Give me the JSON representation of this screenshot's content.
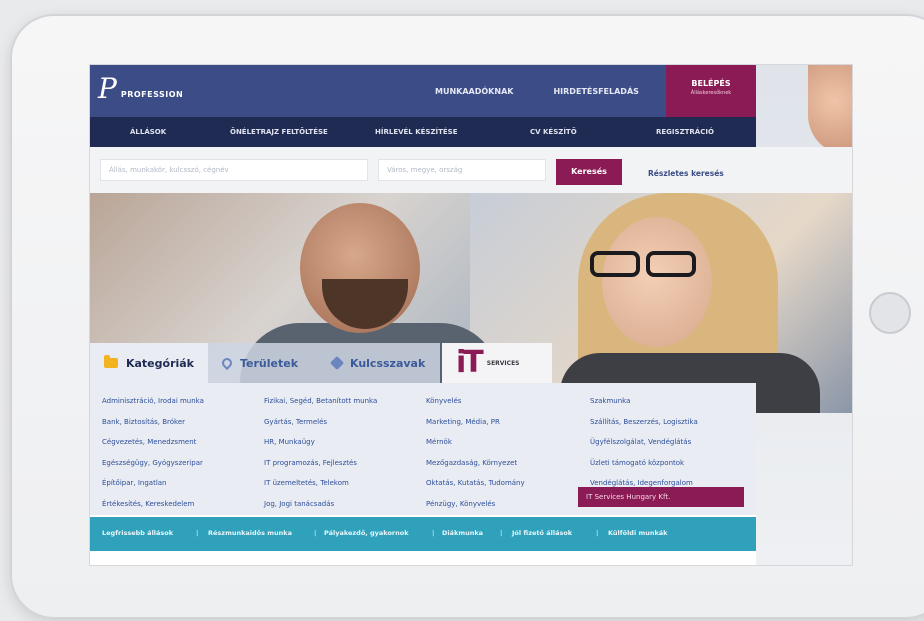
{
  "brand": {
    "logo_letter": "P",
    "name": "PROFESSION"
  },
  "topnav": {
    "items": [
      "MUNKAADÓKNAK",
      "HIRDETÉSFELADÁS"
    ]
  },
  "login": {
    "label": "BELÉPÉS",
    "sub": "Álláskeresőknek"
  },
  "subnav": {
    "items": [
      "ÁLLÁSOK",
      "ÖNÉLETRAJZ FELTÖLTÉSE",
      "HÍRLEVÉL KÉSZÍTÉSE",
      "CV KÉSZÍTŐ",
      "REGISZTRÁCIÓ"
    ]
  },
  "search": {
    "keyword_placeholder": "Állás, munkakör, kulcsszó, cégnév",
    "location_placeholder": "Város, megye, ország",
    "button": "Keresés",
    "advanced": "Részletes keresés"
  },
  "tabs": {
    "categories": "Kategóriák",
    "areas": "Területek",
    "keywords": "Kulcsszavak"
  },
  "it_logo": {
    "mark": "iT",
    "sub": "SERVICES"
  },
  "categories": {
    "col1": [
      "Adminisztráció, Irodai munka",
      "Bank, Biztosítás, Bróker",
      "Cégvezetés, Menedzsment",
      "Egészségügy, Gyógyszeripar",
      "Építőipar, Ingatlan",
      "Értékesítés, Kereskedelem"
    ],
    "col2": [
      "Fizikai, Segéd, Betanított munka",
      "Gyártás, Termelés",
      "HR, Munkaügy",
      "IT programozás, Fejlesztés",
      "IT üzemeltetés, Telekom",
      "Jog, Jogi tanácsadás"
    ],
    "col3": [
      "Könyvelés",
      "Marketing, Média, PR",
      "Mérnök",
      "Mezőgazdaság, Környezet",
      "Oktatás, Kutatás, Tudomány",
      "Pénzügy, Könyvelés"
    ],
    "col4": [
      "Szakmunka",
      "Szállítás, Beszerzés, Logisztika",
      "Ügyfélszolgálat, Vendéglátás",
      "Üzleti támogató központok",
      "Vendéglátás, Idegenforgalom"
    ],
    "highlight": "IT Services Hungary Kft."
  },
  "bottombar": {
    "items": [
      "Legfrissebb állások",
      "Részmunkaidős munka",
      "Pályakezdő, gyakornok",
      "Diákmunka",
      "Jól fizető állások",
      "Külföldi munkák"
    ]
  },
  "colors": {
    "primary": "#3b4c86",
    "dark": "#1f2b52",
    "accent": "#8b1b55",
    "teal": "#2fa1bb"
  }
}
